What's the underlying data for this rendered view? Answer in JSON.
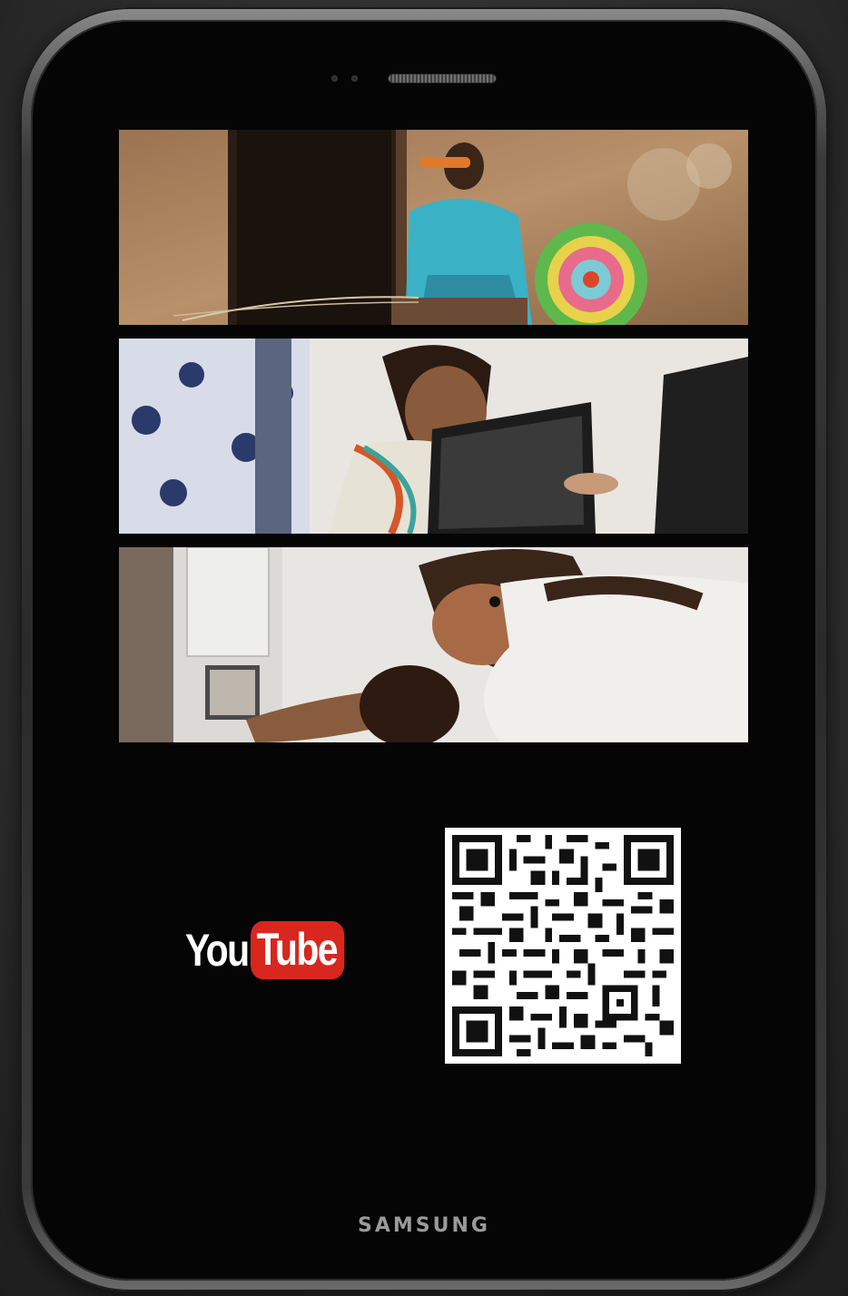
{
  "device": {
    "brand": "SAMSUNG"
  },
  "photos": [
    {
      "subject": "woman-weaving-basket"
    },
    {
      "subject": "woman-at-computer"
    },
    {
      "subject": "women-working-on-equipment"
    }
  ],
  "youtube": {
    "word_you": "You",
    "word_tube": "Tube",
    "brand_color": "#d7271f"
  },
  "qr_code": {
    "icon": "qr-code"
  }
}
